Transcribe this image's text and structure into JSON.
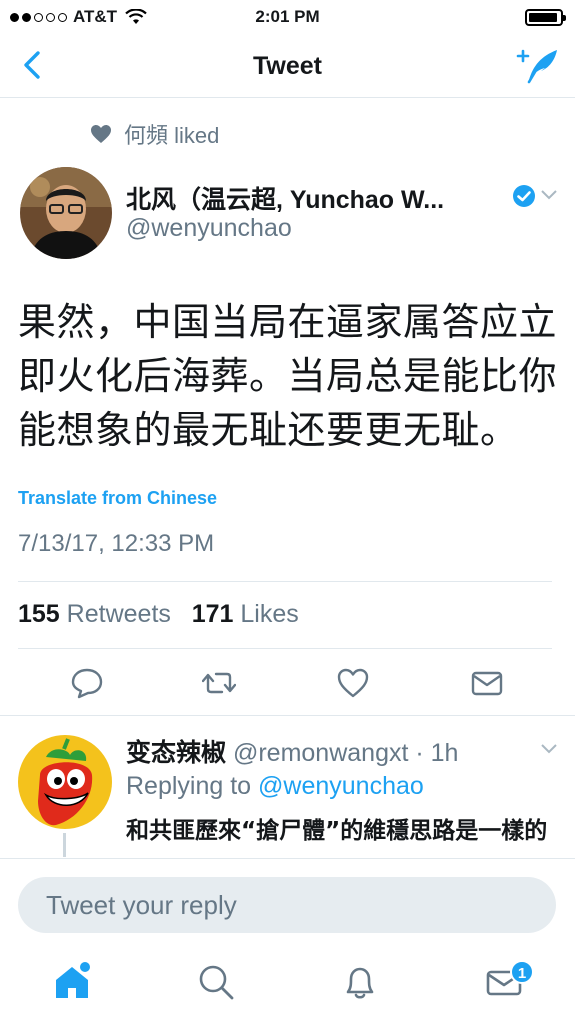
{
  "status_bar": {
    "carrier": "AT&T",
    "time": "2:01 PM",
    "signal_bars": 2,
    "battery_level": 0.9
  },
  "nav": {
    "title": "Tweet",
    "back_icon": "chevron-left-icon",
    "compose_icon": "compose-tweet-icon"
  },
  "context": {
    "liked_by": "何頻",
    "liked_text": "liked"
  },
  "tweet": {
    "author_name": "北风（温云超, Yunchao W...",
    "author_handle": "@wenyunchao",
    "verified": true,
    "text": "果然，中国当局在逼家属答应立即火化后海葬。当局总是能比你能想象的最无耻还要更无耻。",
    "translate_label": "Translate from Chinese",
    "timestamp": "7/13/17, 12:33 PM",
    "retweets_count": "155",
    "retweets_label": "Retweets",
    "likes_count": "171",
    "likes_label": "Likes"
  },
  "reply": {
    "author_name": "变态辣椒",
    "author_handle": "@remonwangxt",
    "time": "· 1h",
    "replying_label": "Replying to",
    "replying_to": "@wenyunchao",
    "text": "和共匪歷來“搶尸體”的維穩思路是一樣的"
  },
  "composer": {
    "placeholder": "Tweet your reply"
  },
  "tab_bar": {
    "notifications_badge": "1"
  },
  "colors": {
    "accent": "#1da1f2",
    "secondary_text": "#657786",
    "divider": "#e1e8ed"
  }
}
